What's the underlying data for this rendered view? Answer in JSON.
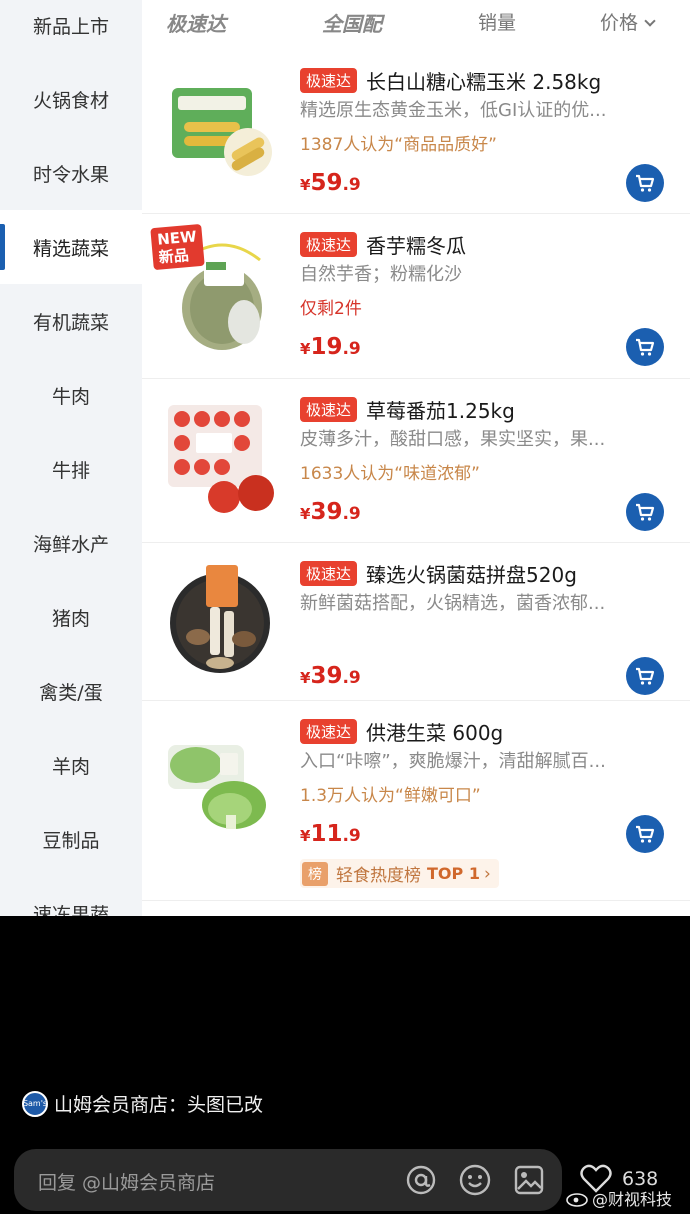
{
  "sidebar": {
    "items": [
      {
        "label": "新品上市"
      },
      {
        "label": "火锅食材"
      },
      {
        "label": "时令水果"
      },
      {
        "label": "精选蔬菜"
      },
      {
        "label": "有机蔬菜"
      },
      {
        "label": "牛肉"
      },
      {
        "label": "牛排"
      },
      {
        "label": "海鲜水产"
      },
      {
        "label": "猪肉"
      },
      {
        "label": "禽类/蛋"
      },
      {
        "label": "羊肉"
      },
      {
        "label": "豆制品"
      },
      {
        "label": "速冻果蔬"
      }
    ],
    "active_index": 3
  },
  "sort_tabs": {
    "express": "极速达",
    "nationwide": "全国配",
    "sales": "销量",
    "price": "价格"
  },
  "products": [
    {
      "tag": "极速达",
      "title": "长白山糖心糯玉米  2.58kg",
      "desc": "精选原生态黄金玉米，低GI认证的优...",
      "sub": "1387人认为“商品品质好”",
      "price_cur": "¥",
      "price_int": "59",
      "price_dec": ".9"
    },
    {
      "tag": "极速达",
      "new_badge": "NEW\n新品",
      "title": "香芋糯冬瓜",
      "desc": "自然芋香；粉糯化沙",
      "sub": "仅剩2件",
      "price_cur": "¥",
      "price_int": "19",
      "price_dec": ".9"
    },
    {
      "tag": "极速达",
      "title": "草莓番茄1.25kg",
      "desc": "皮薄多汁，酸甜口感，果实坚实，果...",
      "sub": "1633人认为“味道浓郁”",
      "price_cur": "¥",
      "price_int": "39",
      "price_dec": ".9"
    },
    {
      "tag": "极速达",
      "title": "臻选火锅菌菇拼盘520g",
      "desc": "新鲜菌菇搭配，火锅精选，菌香浓郁...",
      "sub": "",
      "price_cur": "¥",
      "price_int": "39",
      "price_dec": ".9"
    },
    {
      "tag": "极速达",
      "title": "供港生菜 600g",
      "desc": "入口“咔嚓”，爽脆爆汁，清甜解腻百...",
      "sub": "1.3万人认为“鲜嫩可口”",
      "price_cur": "¥",
      "price_int": "11",
      "price_dec": ".9",
      "rank_icon": "榜",
      "rank_text": "轻食热度榜",
      "rank_top": "TOP 1",
      "rank_arrow": "›"
    }
  ],
  "comment": {
    "author": "山姆会员商店",
    "separator": "：",
    "text": "头图已改",
    "reply_placeholder": "回复 @山姆会员商店",
    "like_count": "638",
    "watermark": "@财视科技"
  },
  "colors": {
    "brand_blue": "#1b5fb0",
    "tag_red": "#e8412f",
    "price_red": "#d6251c",
    "social_proof_orange": "#c8874a"
  },
  "icons": {
    "cart": "cart-icon",
    "mention": "at-icon",
    "emoji": "smile-icon",
    "image": "image-icon",
    "like": "heart-icon",
    "weibo": "weibo-icon"
  }
}
